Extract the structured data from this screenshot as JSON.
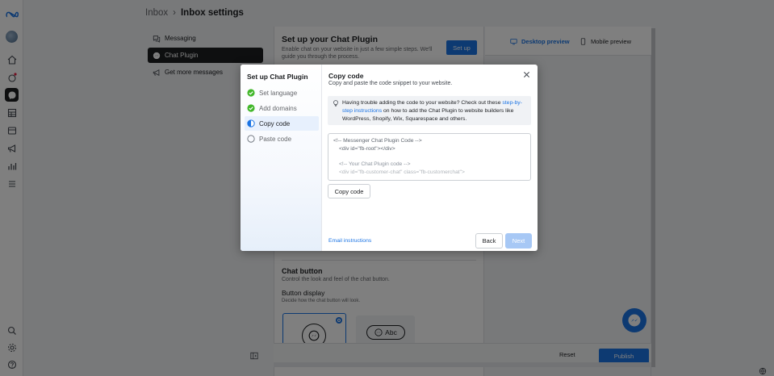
{
  "breadcrumb": {
    "root": "Inbox",
    "separator": "›",
    "current": "Inbox settings"
  },
  "leftnav": {
    "items": [
      {
        "label": "Messaging",
        "icon": "chat-bubbles-icon"
      },
      {
        "label": "Chat Plugin",
        "icon": "messenger-icon",
        "active": true
      },
      {
        "label": "Get more messages",
        "icon": "megaphone-icon"
      }
    ]
  },
  "setup": {
    "title": "Set up your Chat Plugin",
    "description": "Enable chat on your website in just a few simple steps. We'll guide you through the process.",
    "button": "Set up"
  },
  "chat_button": {
    "title": "Chat button",
    "description": "Control the look and feel of the chat button.",
    "display_title": "Button display",
    "display_description": "Decide how the chat button will look.",
    "option_label": "Abc"
  },
  "preview": {
    "desktop": "Desktop preview",
    "mobile": "Mobile preview"
  },
  "footer": {
    "reset": "Reset",
    "publish": "Publish"
  },
  "modal": {
    "steps_title": "Set up Chat Plugin",
    "steps": [
      {
        "label": "Set language",
        "status": "done"
      },
      {
        "label": "Add domains",
        "status": "done"
      },
      {
        "label": "Copy code",
        "status": "active"
      },
      {
        "label": "Paste code",
        "status": "todo"
      }
    ],
    "title": "Copy code",
    "subtitle": "Copy and paste the code snippet to your website.",
    "tip_text": "Having trouble adding the code to your website? Check out these",
    "tip_link": "step-by-step instructions",
    "tip_tail": "on how to add the Chat Plugin to website builders like WordPress, Shopify, Wix, Squarespace and others.",
    "code_lines": [
      "<!-- Messenger Chat Plugin Code -->",
      "<div id=\"fb-root\"></div>",
      "<!-- Your Chat Plugin code -->",
      "<div id=\"fb-customer-chat\" class=\"fb-customerchat\">"
    ],
    "copy_button": "Copy code",
    "email_link": "Email instructions",
    "back": "Back",
    "next": "Next"
  },
  "colors": {
    "accent": "#1b74e4",
    "dark": "#1c1e21",
    "success": "#42b72a"
  }
}
